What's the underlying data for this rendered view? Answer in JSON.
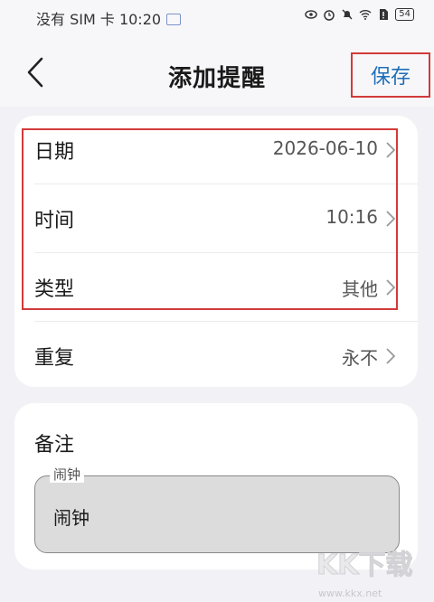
{
  "status_bar": {
    "left_text": "没有 SIM 卡 10:20",
    "battery_level": "54"
  },
  "nav": {
    "title": "添加提醒",
    "save_label": "保存"
  },
  "settings": [
    {
      "label": "日期",
      "value": "2026-06-10"
    },
    {
      "label": "时间",
      "value": "10:16"
    },
    {
      "label": "类型",
      "value": "其他"
    },
    {
      "label": "重复",
      "value": "永不"
    }
  ],
  "note": {
    "title": "备注",
    "legend": "闹钟",
    "value": "闹钟"
  },
  "watermark": {
    "brand": "KK下载",
    "url": "www.kkx.net"
  },
  "colors": {
    "accent": "#1f6fb8",
    "annotation": "#d23a3a",
    "background": "#f2f2f6"
  }
}
